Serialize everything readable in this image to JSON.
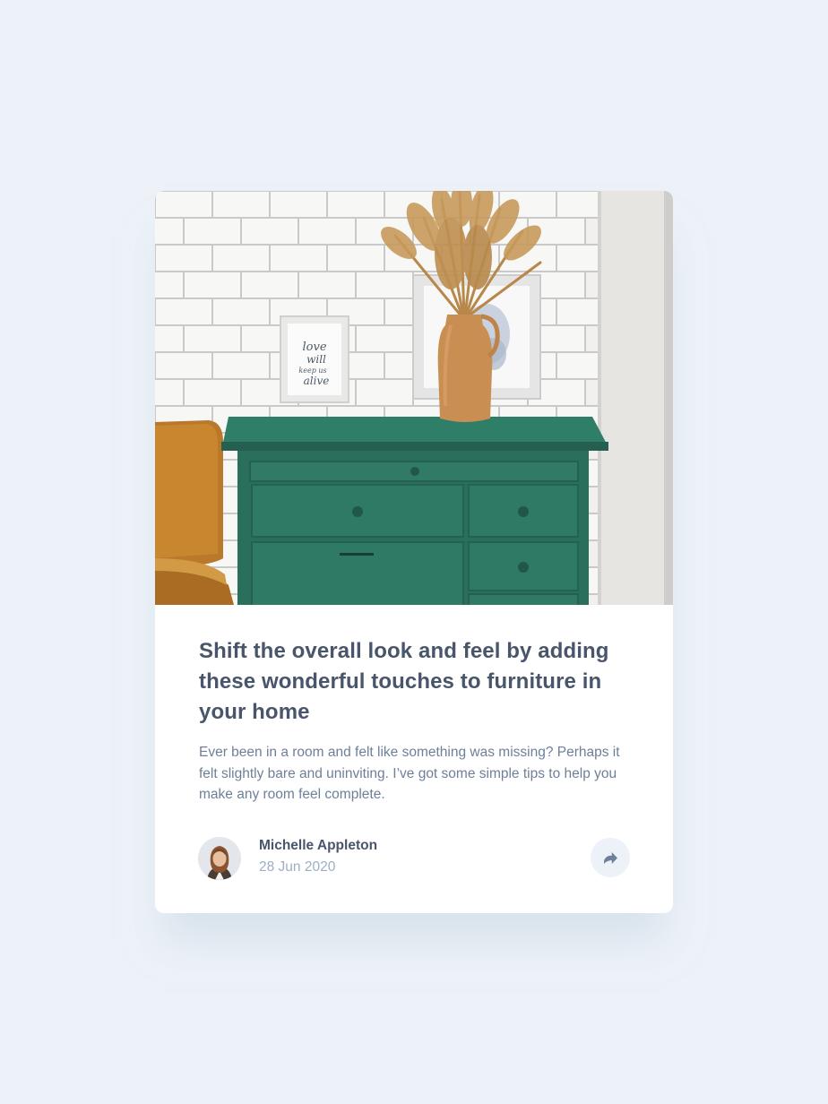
{
  "article": {
    "title": "Shift the overall look and feel by adding these wonderful touches to furniture in your home",
    "description": "Ever been in a room and felt like something was missing? Perhaps it felt slightly bare and uninviting. I’ve got some simple tips to help you make any room feel complete.",
    "image_art_text": "love will keep us alive"
  },
  "author": {
    "name": "Michelle Appleton",
    "date": "28 Jun 2020"
  },
  "share": {
    "icon": "share-icon"
  },
  "colors": {
    "page_background": "#ECF2F8",
    "card_background": "#FFFFFF",
    "title": "#48556A",
    "body_text": "#6E8098",
    "muted_text": "#9DAEC2",
    "share_button_bg": "#ECF2F8",
    "share_icon": "#6E8098"
  }
}
